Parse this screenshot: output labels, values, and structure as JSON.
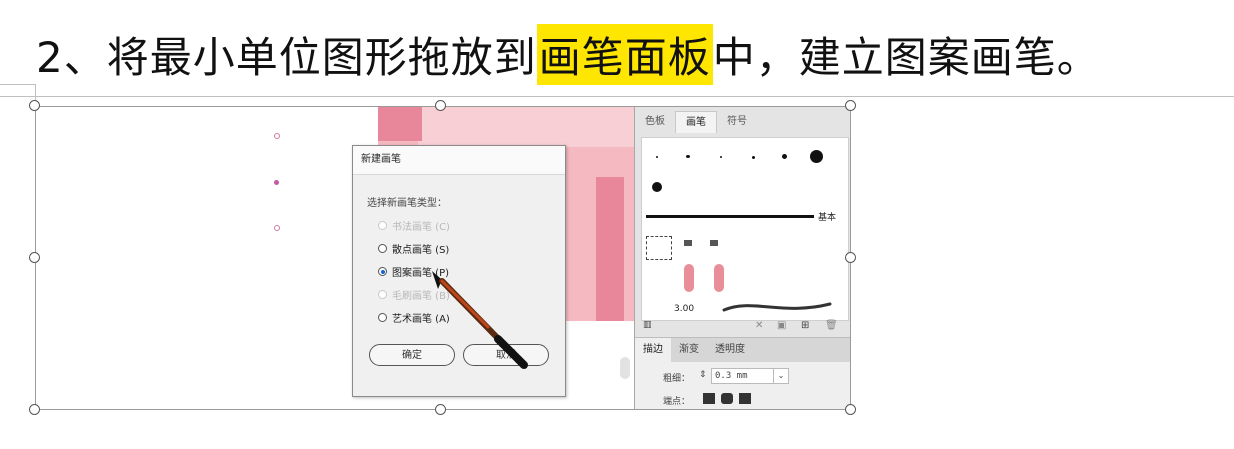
{
  "heading": {
    "before": "2、将最小单位图形拖放到",
    "highlight": "画笔面板",
    "after": "中，建立图案画笔。"
  },
  "dialog": {
    "title": "新建画笔",
    "prompt": "选择新画笔类型：",
    "options": [
      {
        "label": "书法画笔 (C)",
        "disabled": true,
        "selected": false
      },
      {
        "label": "散点画笔 (S)",
        "disabled": false,
        "selected": false
      },
      {
        "label": "图案画笔 (P)",
        "disabled": false,
        "selected": true
      },
      {
        "label": "毛刷画笔 (B)",
        "disabled": true,
        "selected": false
      },
      {
        "label": "艺术画笔 (A)",
        "disabled": false,
        "selected": false
      }
    ],
    "ok_label": "确定",
    "cancel_label": "取消"
  },
  "panel": {
    "tabs": [
      "色板",
      "画笔",
      "符号"
    ],
    "active_tab": "画笔",
    "basic_label": "基本",
    "stroke_size": "3.00",
    "stroke_tabs": [
      "描边",
      "渐变",
      "透明度"
    ],
    "weight_label": "粗细：",
    "weight_value": "0.3 mm",
    "cap_label": "端点："
  },
  "colors": {
    "highlight": "#ffe600",
    "pink_light": "#f4b9c1",
    "pink_dark": "#e8869a",
    "radio_selected": "#1a62d6"
  }
}
